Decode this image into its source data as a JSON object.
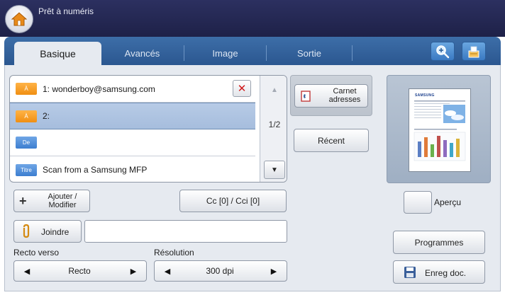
{
  "title_bar": {
    "title": "Prêt à numéris"
  },
  "tabs": [
    {
      "label": "Basique",
      "active": true
    },
    {
      "label": "Avancés",
      "active": false
    },
    {
      "label": "Image",
      "active": false
    },
    {
      "label": "Sortie",
      "active": false
    }
  ],
  "toolbar": {
    "icons": [
      "zoom-icon",
      "job-status-icon"
    ]
  },
  "address_list": {
    "rows": [
      {
        "tag": "À",
        "value": "1: wonderboy@samsung.com",
        "tag_color": "#f39c1e"
      },
      {
        "tag": "À",
        "value": "2:",
        "tag_color": "#f39c1e"
      },
      {
        "tag": "De",
        "value": "",
        "tag_color": "#3c7ed0"
      },
      {
        "tag": "Titre",
        "value": "Scan from a Samsung MFP",
        "tag_color": "#3c7ed0"
      }
    ],
    "page_indicator": "1/2"
  },
  "buttons": {
    "address_book_line1": "Carnet",
    "address_book_line2": "adresses",
    "recent": "Récent",
    "add_modify_line1": "Ajouter /",
    "add_modify_line2": "Modifier",
    "cc": "Cc [0] / Cci [0]",
    "attach": "Joindre",
    "preview": "Aperçu",
    "programs": "Programmes",
    "save_doc": "Enreg doc."
  },
  "attach_field": {
    "value": ""
  },
  "duplex": {
    "label": "Recto verso",
    "value": "Recto"
  },
  "resolution": {
    "label": "Résolution",
    "value": "300 dpi"
  },
  "preview_thumbnail": {
    "logo_text": "SAMSUNG",
    "bar_colors": [
      "#5b7fc4",
      "#e07b3a",
      "#6ab04c",
      "#c0504d",
      "#8e6bbf",
      "#3fa7c9",
      "#d9b33a"
    ]
  },
  "colors": {
    "title_bar": "#23264f",
    "tab_bar": "#3465a4",
    "panel_bg": "#e6eaf0",
    "selected_row": "#aec4e2"
  }
}
